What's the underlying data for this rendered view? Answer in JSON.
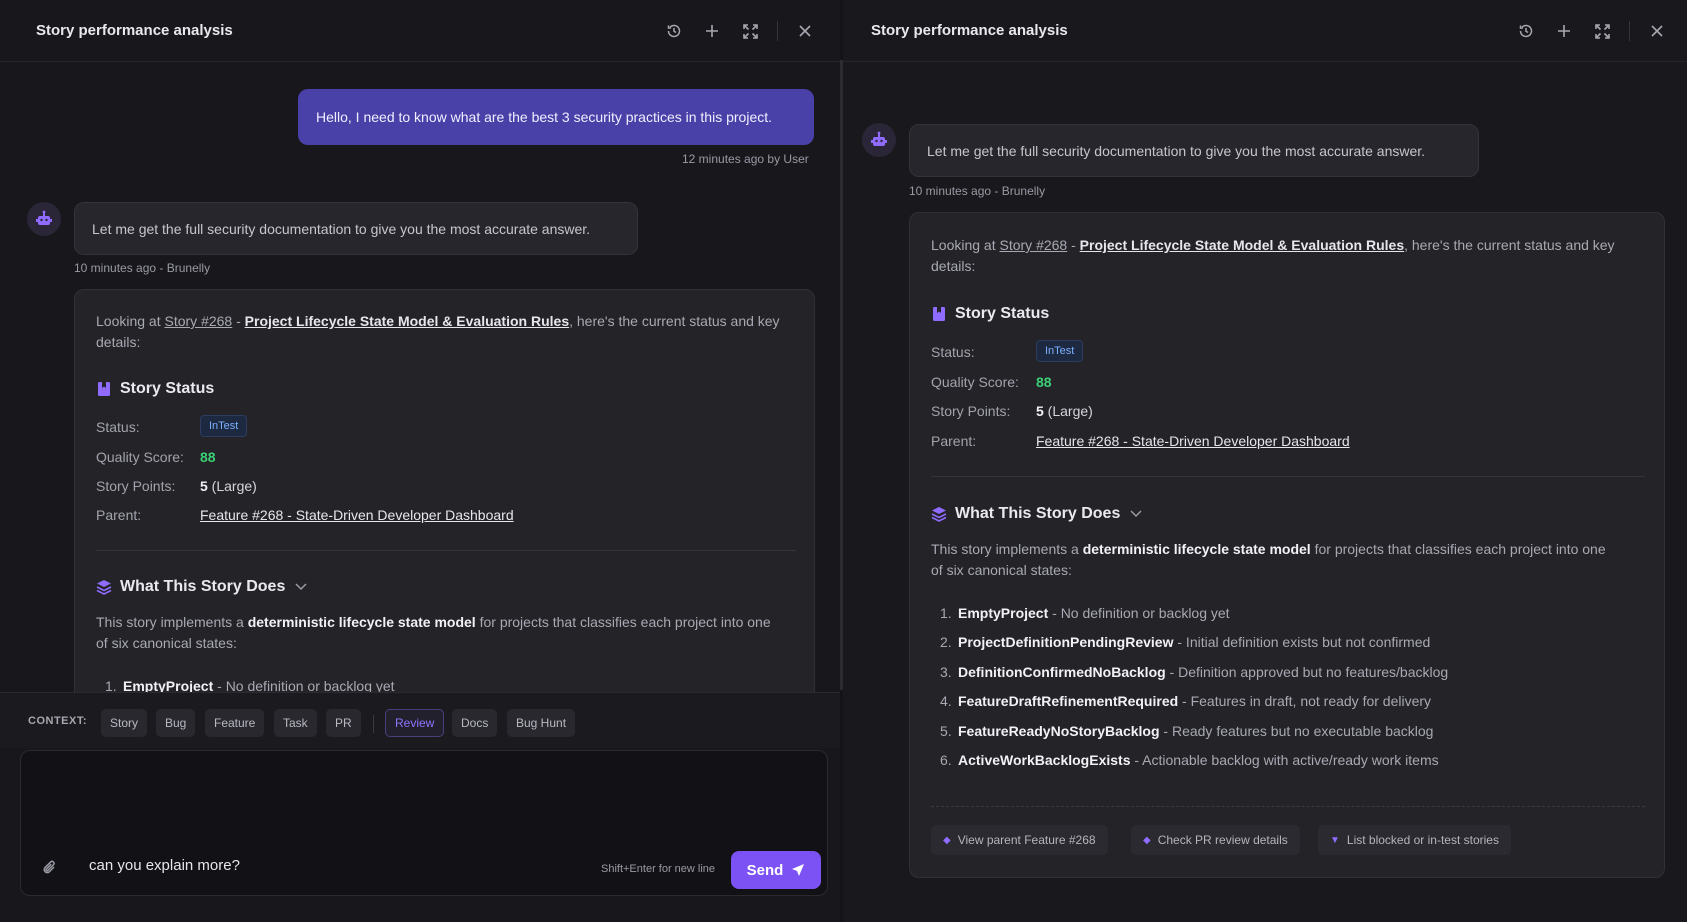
{
  "panels": [
    {
      "title": "Story performance analysis",
      "user_message": "Hello, I need to know what are the best 3 security practices in this project.",
      "user_meta": "12 minutes ago by User",
      "bot_message": "Let me get the full security documentation to give you the most accurate answer.",
      "bot_meta": "10 minutes ago - Brunelly",
      "card": {
        "intro_prefix": "Looking at ",
        "story_ref": "Story #268",
        "dash": " - ",
        "story_title": "Project Lifecycle State Model & Evaluation Rules",
        "intro_suffix_1": ", here's the current status and key",
        "intro_suffix_2": "details:",
        "status_section": "Story Status",
        "status_label": "Status:",
        "status_value": "InTest",
        "quality_label": "Quality Score:",
        "quality_value": "88",
        "points_label": "Story Points:",
        "points_value": "5",
        "points_note": " (Large)",
        "parent_label": "Parent:",
        "parent_value": "Feature #268 - State-Driven Developer Dashboard",
        "what_section": "What This Story Does",
        "desc_prefix": "This story implements a ",
        "desc_bold": "deterministic lifecycle state model",
        "desc_suffix_l1": " for projects that classifies each project into one",
        "desc_suffix_l2": "of six canonical states:",
        "states": [
          {
            "num": "1.",
            "name": "EmptyProject",
            "desc": " - No definition or backlog yet"
          }
        ]
      },
      "context": {
        "label": "CONTEXT:",
        "chips": [
          "Story",
          "Bug",
          "Feature",
          "Task",
          "PR",
          "Review",
          "Docs",
          "Bug Hunt"
        ],
        "active": "Review"
      },
      "composer": {
        "value": "can you explain more?",
        "hint": "Shift+Enter for new line",
        "send": "Send"
      }
    },
    {
      "title": "Story performance analysis",
      "bot_message": "Let me get the full security documentation to give you the most accurate answer.",
      "bot_meta": "10 minutes ago - Brunelly",
      "card": {
        "intro_prefix": "Looking at ",
        "story_ref": "Story #268",
        "dash": " - ",
        "story_title": "Project Lifecycle State Model & Evaluation Rules",
        "intro_suffix_1": ", here's the current status and key",
        "intro_suffix_2": "details:",
        "status_section": "Story Status",
        "status_label": "Status:",
        "status_value": "InTest",
        "quality_label": "Quality Score:",
        "quality_value": "88",
        "points_label": "Story Points:",
        "points_value": "5",
        "points_note": " (Large)",
        "parent_label": "Parent:",
        "parent_value": "Feature #268 - State-Driven Developer Dashboard",
        "what_section": "What This Story Does",
        "desc_prefix": "This story implements a ",
        "desc_bold": "deterministic lifecycle state model",
        "desc_suffix_l1": " for projects that classifies each project into one",
        "desc_suffix_l2": "of six canonical states:",
        "states": [
          {
            "num": "1.",
            "name": "EmptyProject",
            "desc": " - No definition or backlog yet"
          },
          {
            "num": "2.",
            "name": "ProjectDefinitionPendingReview",
            "desc": " - Initial definition exists but not confirmed"
          },
          {
            "num": "3.",
            "name": "DefinitionConfirmedNoBacklog",
            "desc": " - Definition approved but no features/backlog"
          },
          {
            "num": "4.",
            "name": "FeatureDraftRefinementRequired",
            "desc": " - Features in draft, not ready for delivery"
          },
          {
            "num": "5.",
            "name": "FeatureReadyNoStoryBacklog",
            "desc": " - Ready features but no executable backlog"
          },
          {
            "num": "6.",
            "name": "ActiveWorkBacklogExists",
            "desc": " - Actionable backlog with active/ready work items"
          }
        ],
        "actions": [
          "View parent Feature #268",
          "Check PR review details",
          "List blocked or in-test stories"
        ]
      }
    }
  ],
  "colors": {
    "accent": "#7d52f4",
    "user_bubble": "#4a41a8",
    "score": "#3ccf76",
    "badge_text": "#7cb1ff"
  },
  "icons": [
    "history-icon",
    "plus-icon",
    "expand-icon",
    "close-icon",
    "bot-avatar-icon",
    "bookmark-icon",
    "layers-icon",
    "chevron-down-icon",
    "paperclip-icon",
    "send-icon"
  ]
}
